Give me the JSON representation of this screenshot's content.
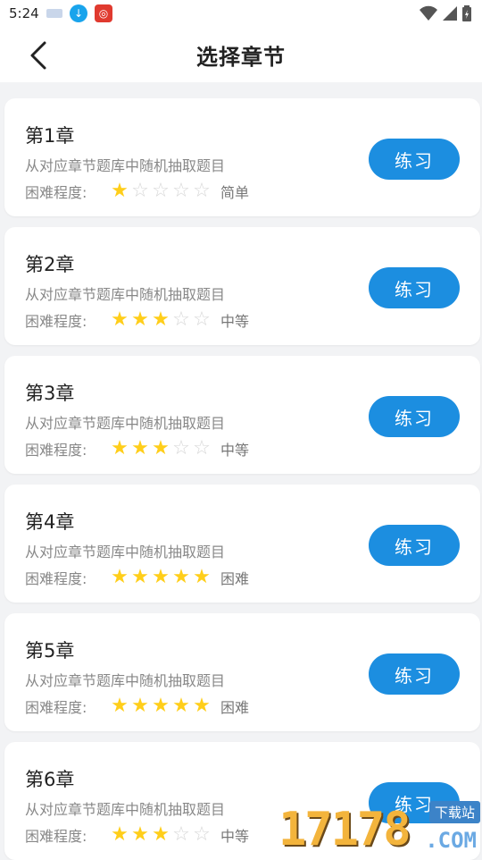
{
  "status_bar": {
    "time": "5:24"
  },
  "header": {
    "title": "选择章节"
  },
  "chapters": [
    {
      "title": "第1章",
      "desc": "从对应章节题库中随机抽取题目",
      "difficulty_label": "困难程度:",
      "stars": 1,
      "max_stars": 5,
      "difficulty_text": "简单",
      "button": "练习"
    },
    {
      "title": "第2章",
      "desc": "从对应章节题库中随机抽取题目",
      "difficulty_label": "困难程度:",
      "stars": 3,
      "max_stars": 5,
      "difficulty_text": "中等",
      "button": "练习"
    },
    {
      "title": "第3章",
      "desc": "从对应章节题库中随机抽取题目",
      "difficulty_label": "困难程度:",
      "stars": 3,
      "max_stars": 5,
      "difficulty_text": "中等",
      "button": "练习"
    },
    {
      "title": "第4章",
      "desc": "从对应章节题库中随机抽取题目",
      "difficulty_label": "困难程度:",
      "stars": 5,
      "max_stars": 5,
      "difficulty_text": "困难",
      "button": "练习"
    },
    {
      "title": "第5章",
      "desc": "从对应章节题库中随机抽取题目",
      "difficulty_label": "困难程度:",
      "stars": 5,
      "max_stars": 5,
      "difficulty_text": "困难",
      "button": "练习"
    },
    {
      "title": "第6章",
      "desc": "从对应章节题库中随机抽取题目",
      "difficulty_label": "困难程度:",
      "stars": 3,
      "max_stars": 5,
      "difficulty_text": "中等",
      "button": "练习"
    }
  ],
  "watermark": {
    "number": "17178",
    "tag": "下载站",
    "domain": ".COM"
  },
  "colors": {
    "accent": "#1c8ee0",
    "star_on": "#ffce1a",
    "star_off": "#d6d6d6",
    "background": "#f2f3f5"
  }
}
